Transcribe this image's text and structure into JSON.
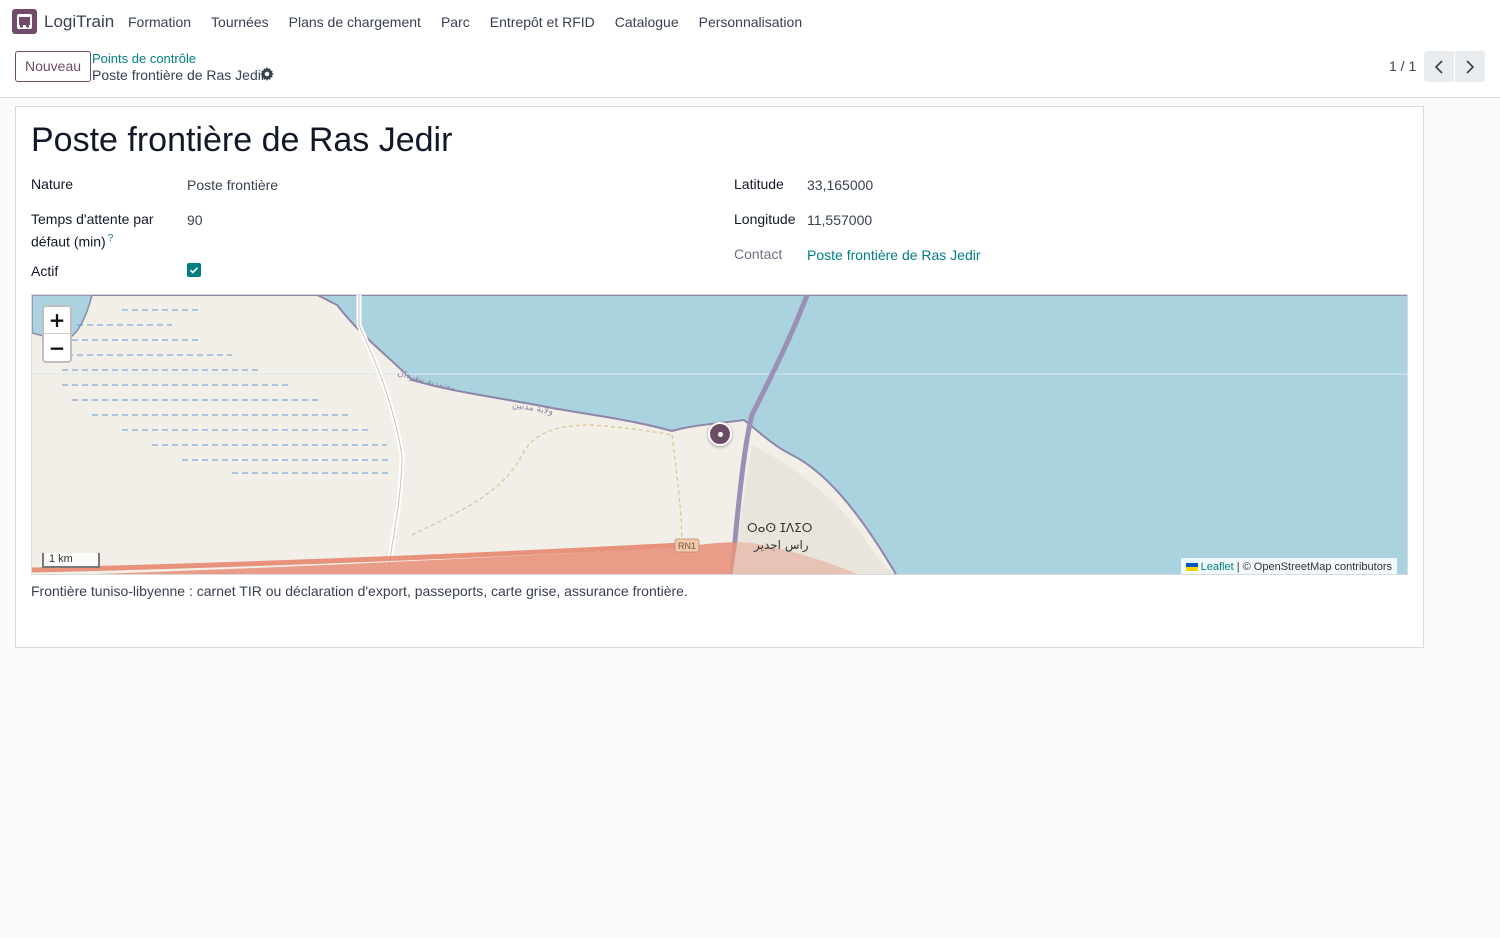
{
  "app": {
    "name": "LogiTrain",
    "icon": "truck-app-icon",
    "brand_color": "#714b67",
    "accent_color": "#017e84"
  },
  "menu": [
    {
      "label": "Formation"
    },
    {
      "label": "Tournées"
    },
    {
      "label": "Plans de chargement"
    },
    {
      "label": "Parc"
    },
    {
      "label": "Entrepôt et RFID"
    },
    {
      "label": "Catalogue"
    },
    {
      "label": "Personnalisation"
    }
  ],
  "control_panel": {
    "new_button": "Nouveau",
    "breadcrumb_parent": "Points de contrôle",
    "breadcrumb_current": "Poste frontière de Ras Jedir",
    "pager": "1 / 1"
  },
  "record": {
    "title": "Poste frontière de Ras Jedir",
    "nature_label": "Nature",
    "nature_value": "Poste frontière",
    "wait_label_line1": "Temps d'attente par",
    "wait_label_line2": "défaut (min)",
    "wait_help": "?",
    "wait_value": "90",
    "active_label": "Actif",
    "active_checked": true,
    "latitude_label": "Latitude",
    "latitude_value": "33,165000",
    "longitude_label": "Longitude",
    "longitude_value": "11,557000",
    "contact_label": "Contact",
    "contact_value": "Poste frontière de Ras Jedir",
    "description": "Frontière tuniso-libyenne : carnet TIR ou déclaration d'export, passeports, carte grise, assurance frontière."
  },
  "map": {
    "zoom_in": "+",
    "zoom_out": "−",
    "scale_label": "1 km",
    "attribution_link": "Leaflet",
    "attribution_text": "| © OpenStreetMap contributors",
    "road_label": "RN1",
    "place_label_tifinagh": "ⵔⴰⵙ ⵊⴷⵉⵔ",
    "place_label_arabic": "راس اجدير",
    "region_label_1": "معتمدية بنقردان",
    "region_label_2": "ولاية مدنين",
    "sea_color": "#aad3df",
    "land_color": "#f2efe9",
    "marker_color": "#6b4c64"
  }
}
